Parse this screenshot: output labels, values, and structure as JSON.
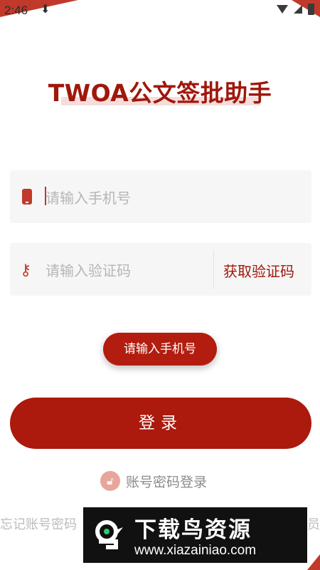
{
  "status_bar": {
    "time": "2:46",
    "download_glyph": "⬇"
  },
  "title": "TWOA公文签批助手",
  "phone_field": {
    "placeholder": "请输入手机号",
    "icon": "phone-icon"
  },
  "code_field": {
    "placeholder": "请输入验证码",
    "icon": "key-icon",
    "get_code_label": "获取验证码"
  },
  "toast": "请输入手机号",
  "login_button": "登录",
  "account_login": {
    "label": "账号密码登录",
    "icon": "lock-icon"
  },
  "footer": {
    "forgot_label": "忘记账号密码",
    "right_label": "理员"
  },
  "watermark": {
    "title": "下载鸟资源",
    "url": "www.xiazainiao.com"
  },
  "colors": {
    "brand": "#ab1a0c",
    "accent": "#c0392b",
    "field_bg": "#f6f6f6"
  }
}
